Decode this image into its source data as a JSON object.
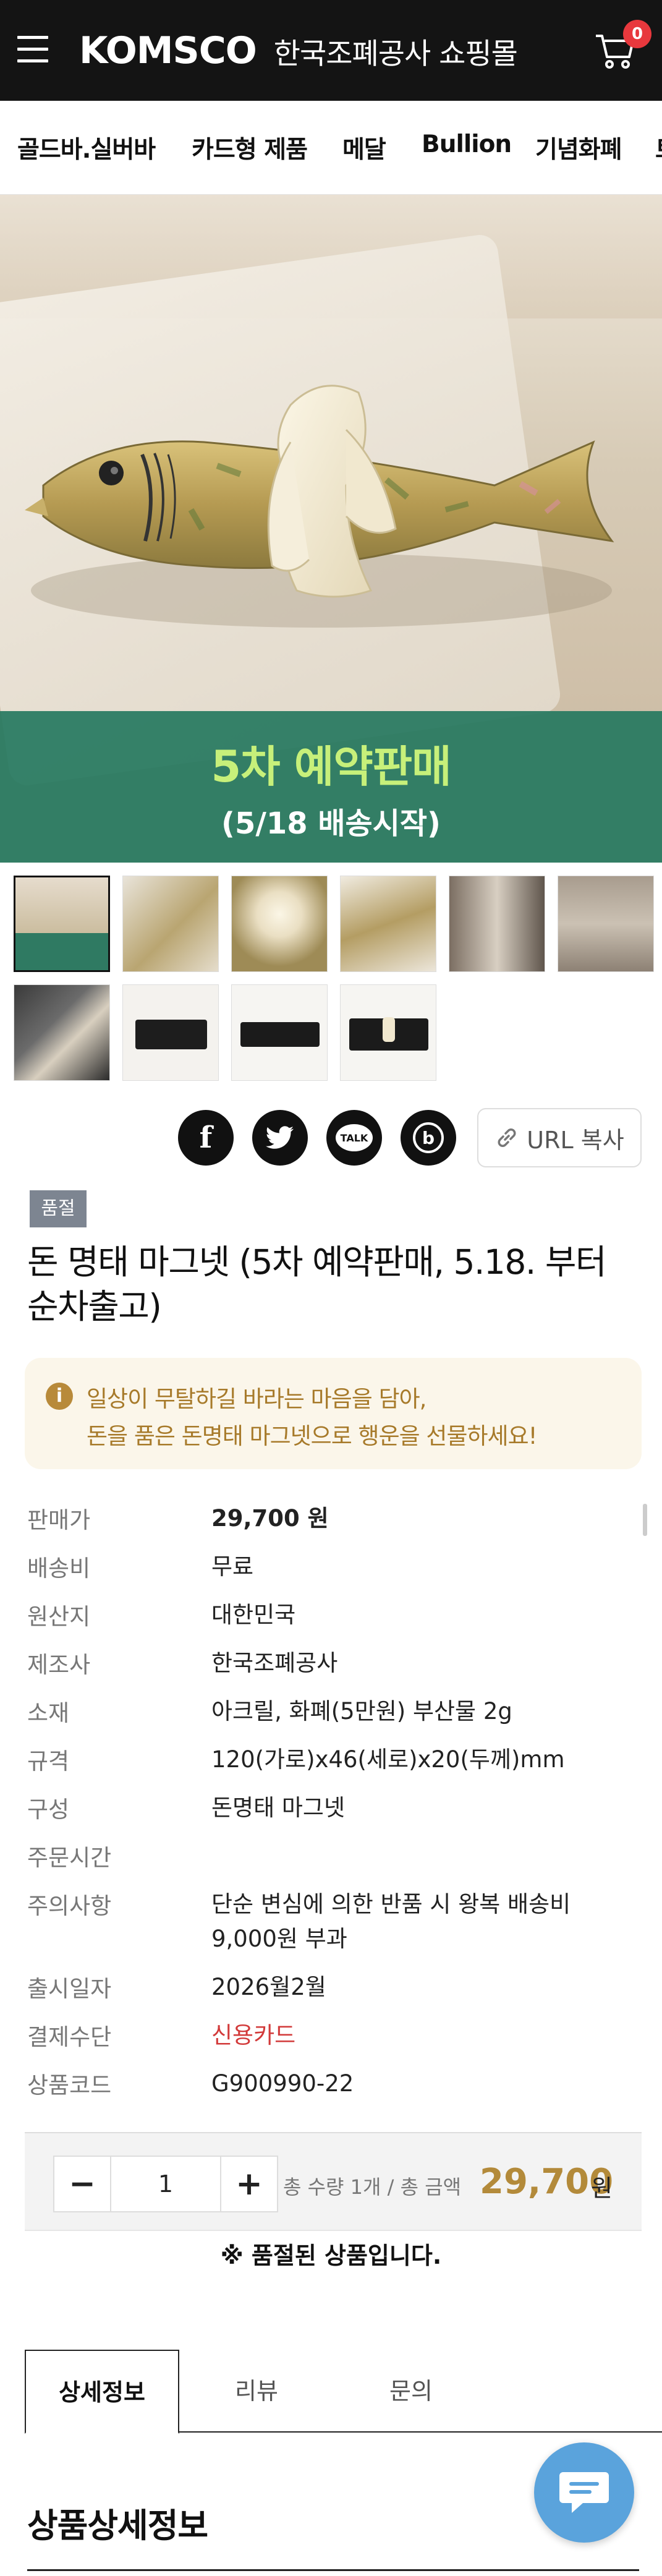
{
  "header": {
    "brand": "KOMSCO",
    "brand_sub": "한국조폐공사 쇼핑몰",
    "cart_count": "0"
  },
  "categories": [
    "골드바.실버바",
    "카드형 제품",
    "메달",
    "Bullion",
    "기념화폐",
    "트"
  ],
  "hero": {
    "banner_main": "5차 예약판매",
    "banner_sub": "(5/18 배송시작)"
  },
  "share": {
    "facebook": "f",
    "kakao_talk": "TALK",
    "blog": "b",
    "url_copy": "URL 복사"
  },
  "product": {
    "badge": "품절",
    "title": "돈 명태 마그넷 (5차 예약판매, 5.18. 부터 순차출고)",
    "notice_line1": "일상이 무탈하길 바라는 마음을 담아,",
    "notice_line2": "돈을 품은 돈명태 마그넷으로 행운을 선물하세요!",
    "info": [
      {
        "label": "판매가",
        "value": "29,700 원"
      },
      {
        "label": "배송비",
        "value": "무료"
      },
      {
        "label": "원산지",
        "value": "대한민국"
      },
      {
        "label": "제조사",
        "value": "한국조폐공사"
      },
      {
        "label": "소재",
        "value": "아크릴, 화폐(5만원) 부산물 2g"
      },
      {
        "label": "규격",
        "value": "120(가로)x46(세로)x20(두께)mm"
      },
      {
        "label": "구성",
        "value": "돈명태 마그넷"
      },
      {
        "label": "주문시간",
        "value": ""
      },
      {
        "label": "주의사항",
        "value": "단순 변심에 의한 반품 시 왕복 배송비 9,000원 부과"
      },
      {
        "label": "출시일자",
        "value": "2026월2월"
      },
      {
        "label": "결제수단",
        "value": "신용카드"
      },
      {
        "label": "상품코드",
        "value": "G900990-22"
      }
    ]
  },
  "purchase": {
    "minus": "−",
    "quantity": "1",
    "plus": "+",
    "total_label": "총 수량 1개 / 총 금액",
    "total_amount": "29,700",
    "total_unit": "원",
    "soldout_note": "※ 품절된 상품입니다."
  },
  "tabs": [
    "상세정보",
    "리뷰",
    "문의"
  ],
  "section_title": "상품상세정보",
  "colors": {
    "header_bg": "#141414",
    "accent_gold": "#b38a3a",
    "banner_green": "#267860",
    "banner_text": "#c7f07a",
    "badge_gray": "#7d8591",
    "cart_badge": "#e8383d",
    "chat_blue": "#5aa3dc"
  }
}
